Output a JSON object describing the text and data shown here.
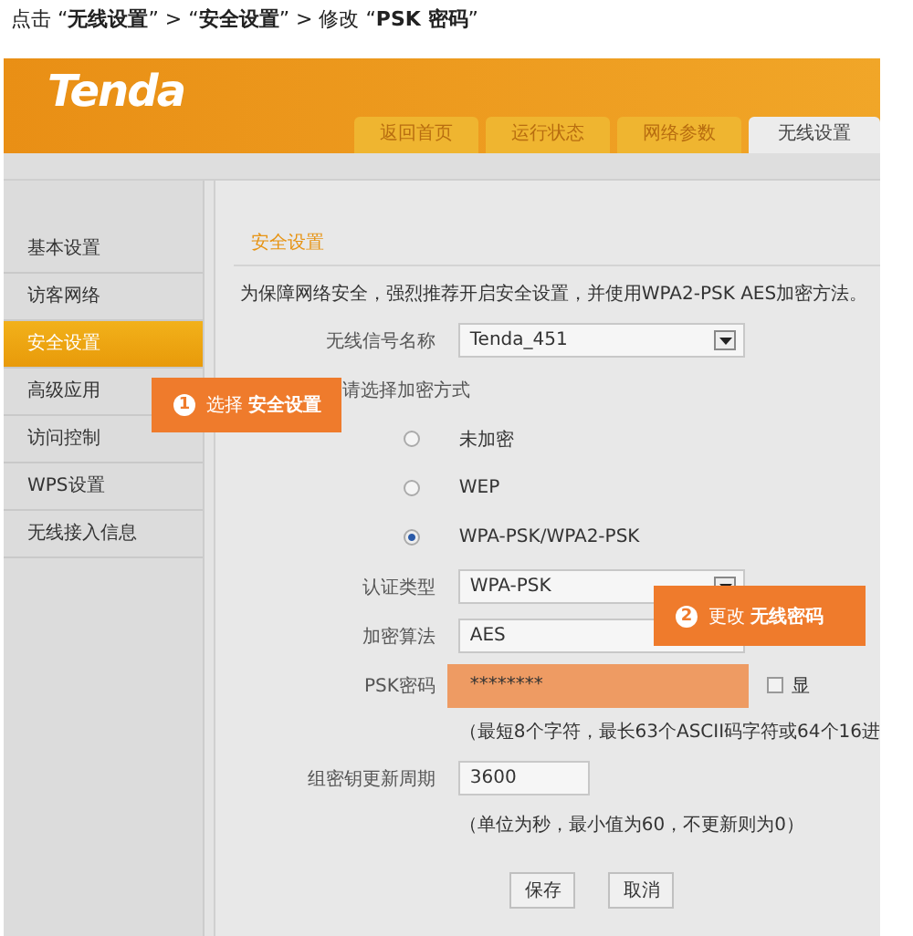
{
  "instruction": "点击 “**无线设置**” > “**安全设置**” > 修改 “**PSK 密码**”",
  "header": {
    "logo": "Tenda",
    "tabs": [
      {
        "label": "返回首页",
        "selected": false
      },
      {
        "label": "运行状态",
        "selected": false
      },
      {
        "label": "网络参数",
        "selected": false
      },
      {
        "label": "无线设置",
        "selected": true
      }
    ]
  },
  "sidebar": {
    "items": [
      {
        "label": "基本设置",
        "selected": false
      },
      {
        "label": "访客网络",
        "selected": false
      },
      {
        "label": "安全设置",
        "selected": true
      },
      {
        "label": "高级应用",
        "selected": false
      },
      {
        "label": "访问控制",
        "selected": false
      },
      {
        "label": "WPS设置",
        "selected": false
      },
      {
        "label": "无线接入信息",
        "selected": false
      }
    ]
  },
  "content": {
    "section_title": "安全设置",
    "notice": "为保障网络安全，强烈推荐开启安全设置，并使用WPA2-PSK AES加密方法。",
    "rows": [
      {
        "kind": "select",
        "label": "无线信号名称",
        "value": "Tenda_451"
      },
      {
        "kind": "heading",
        "label": "请选择加密方式"
      },
      {
        "kind": "radio",
        "label": "未加密",
        "selected": false
      },
      {
        "kind": "radio",
        "label": "WEP",
        "selected": false
      },
      {
        "kind": "radio",
        "label": "WPA-PSK/WPA2-PSK",
        "selected": true
      },
      {
        "kind": "select",
        "label": "认证类型",
        "value": "WPA-PSK"
      },
      {
        "kind": "text",
        "label": "加密算法",
        "value": "AES"
      },
      {
        "kind": "password",
        "label": "PSK密码",
        "value": "********",
        "highlighted": true,
        "option": {
          "label": "显",
          "checked": false
        }
      },
      {
        "kind": "hint",
        "text": "（最短8个字符，最长63个ASCII码字符或64个16进"
      },
      {
        "kind": "short",
        "label": "组密钥更新周期",
        "value": "3600"
      },
      {
        "kind": "hint",
        "text": "（单位为秒，最小值为60，不更新则为0）"
      }
    ],
    "buttons": [
      "保存",
      "取消"
    ]
  },
  "callouts": [
    {
      "number": "1",
      "text": "选择 **安全设置**"
    },
    {
      "number": "2",
      "text": "更改 **无线密码**"
    }
  ]
}
